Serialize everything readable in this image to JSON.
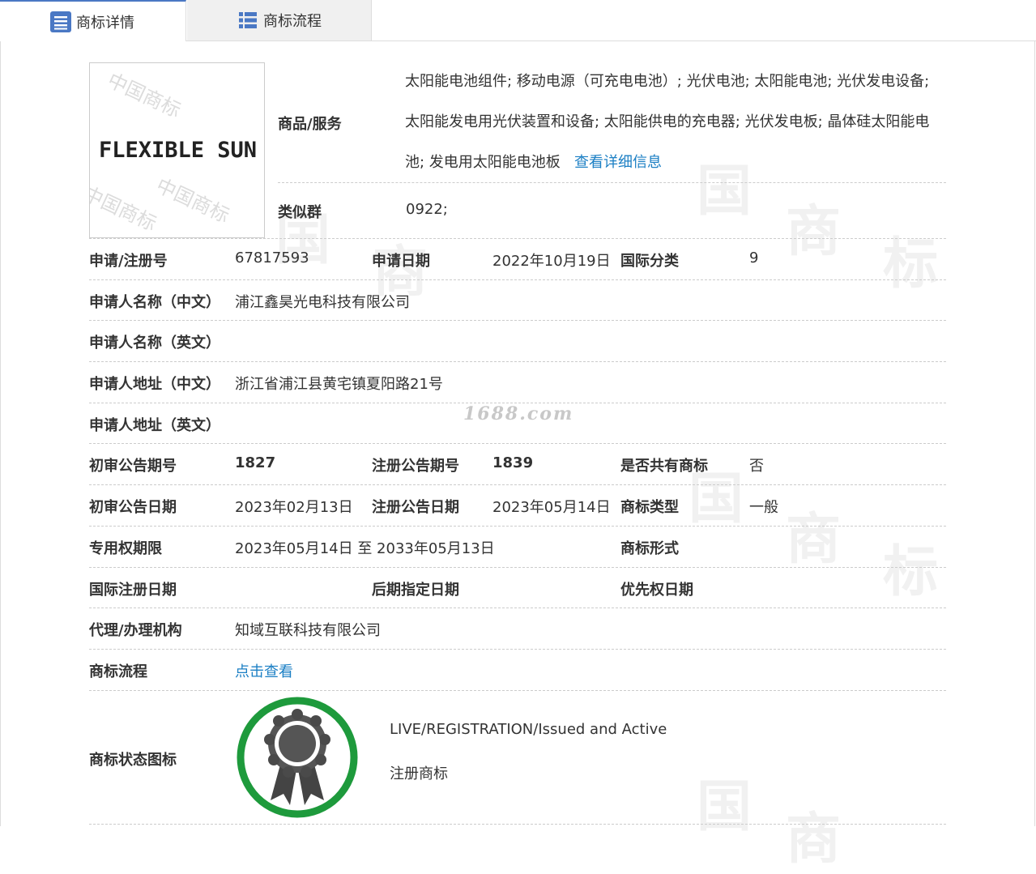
{
  "tabs": [
    {
      "label": "商标详情",
      "icon": "list-lines-icon"
    },
    {
      "label": "商标流程",
      "icon": "list-bullets-icon"
    }
  ],
  "logo": {
    "text": "FLEXIBLE SUN"
  },
  "goods": {
    "label": "商品/服务",
    "text": "太阳能电池组件; 移动电源（可充电电池）; 光伏电池; 太阳能电池; 光伏发电设备; 太阳能发电用光伏装置和设备; 太阳能供电的充电器; 光伏发电板; 晶体硅太阳能电池; 发电用太阳能电池板",
    "link": "查看详细信息"
  },
  "similar_group": {
    "label": "类似群",
    "value": "0922;"
  },
  "fields": {
    "reg_no_label": "申请/注册号",
    "reg_no": "67817593",
    "apply_date_label": "申请日期",
    "apply_date": "2022年10月19日",
    "intl_class_label": "国际分类",
    "intl_class": "9",
    "applicant_cn_label": "申请人名称（中文）",
    "applicant_cn": "浦江鑫昊光电科技有限公司",
    "applicant_en_label": "申请人名称（英文）",
    "applicant_en": "",
    "address_cn_label": "申请人地址（中文）",
    "address_cn": "浙江省浦江县黄宅镇夏阳路21号",
    "address_en_label": "申请人地址（英文）",
    "address_en": "",
    "prelim_no_label": "初审公告期号",
    "prelim_no": "1827",
    "reg_pub_no_label": "注册公告期号",
    "reg_pub_no": "1839",
    "shared_label": "是否共有商标",
    "shared": "否",
    "prelim_date_label": "初审公告日期",
    "prelim_date": "2023年02月13日",
    "reg_pub_date_label": "注册公告日期",
    "reg_pub_date": "2023年05月14日",
    "type_label": "商标类型",
    "type": "一般",
    "term_label": "专用权期限",
    "term": "2023年05月14日 至 2033年05月13日",
    "form_label": "商标形式",
    "form": "",
    "intl_reg_date_label": "国际注册日期",
    "intl_reg_date": "",
    "later_date_label": "后期指定日期",
    "later_date": "",
    "priority_date_label": "优先权日期",
    "priority_date": "",
    "agent_label": "代理/办理机构",
    "agent": "知域互联科技有限公司",
    "process_label": "商标流程",
    "process_link": "点击查看",
    "status_icon_label": "商标状态图标",
    "status_en": "LIVE/REGISTRATION/Issued and Active",
    "status_cn": "注册商标"
  },
  "watermark_site": "1688.com",
  "colors": {
    "link": "#1b7fc4",
    "badge_ring": "#1e9a3c",
    "tab_accent": "#4a78c4"
  }
}
